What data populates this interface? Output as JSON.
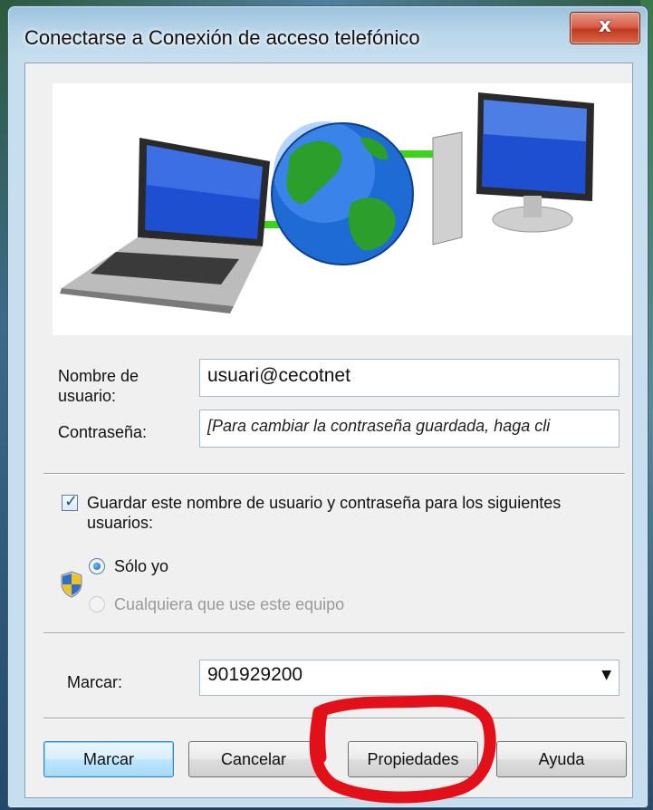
{
  "window": {
    "title": "Conectarse a Conexión de acceso telefónico",
    "close_label": "x"
  },
  "form": {
    "username_label": "Nombre de usuario:",
    "username_value": "usuari@cecotnet",
    "password_label": "Contraseña:",
    "password_value": "[Para cambiar la contraseña guardada, haga cli",
    "save_checkbox_label": "Guardar este nombre de usuario y contraseña para los siguientes usuarios:",
    "save_checked": true,
    "radio_only_me": "Sólo yo",
    "radio_anyone": "Cualquiera que use este equipo",
    "dial_label": "Marcar:",
    "dial_value": "901929200"
  },
  "buttons": {
    "dial": "Marcar",
    "cancel": "Cancelar",
    "properties": "Propiedades",
    "help": "Ayuda"
  },
  "icons": {
    "shield": "uac-shield-icon",
    "dropdown": "chevron-down-icon",
    "laptop": "laptop-icon",
    "globe": "globe-icon",
    "desktop": "desktop-computer-icon"
  },
  "colors": {
    "annotation_red": "#e3101a",
    "link_green": "#3bd41a"
  }
}
